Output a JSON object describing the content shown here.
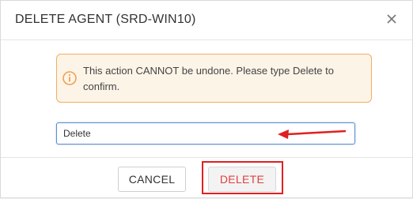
{
  "dialog": {
    "title": "DELETE AGENT (SRD-WIN10)",
    "close_icon": "close-icon"
  },
  "alert": {
    "icon": "info-icon",
    "message": "This action CANNOT be undone. Please type Delete to confirm.",
    "colors": {
      "border": "#f0ad65",
      "background": "#fdf4e8"
    }
  },
  "confirm_input": {
    "value": "Delete"
  },
  "annotation": {
    "arrow_icon": "left-arrow-icon",
    "color": "#e02020"
  },
  "footer": {
    "cancel_label": "CANCEL",
    "delete_label": "DELETE"
  }
}
